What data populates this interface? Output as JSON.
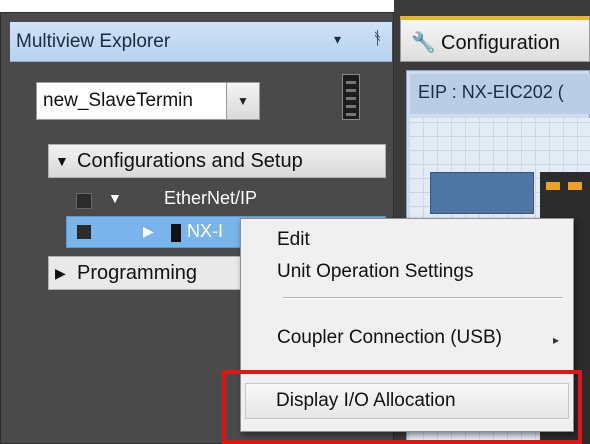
{
  "explorer": {
    "title": "Multiview Explorer",
    "dropdown_glyph": "▾",
    "pin_glyph": "ᚬ",
    "device_select": {
      "value": "new_SlaveTermin",
      "arrow": "▼"
    },
    "sections": {
      "configurations": {
        "label": "Configurations and Setup",
        "expander": "▼"
      },
      "programming": {
        "label": "Programming",
        "expander": "▶"
      }
    },
    "tree": {
      "ethernet_ip": {
        "label": "EtherNet/IP",
        "expander": "▼"
      },
      "nx_node": {
        "label": "NX-I",
        "expander": "▶"
      }
    }
  },
  "editor": {
    "tab_label": "Configuration",
    "canvas_header": "EIP : NX-EIC202 ("
  },
  "context_menu": {
    "items": [
      {
        "label": "Edit"
      },
      {
        "label": "Unit Operation Settings"
      },
      {
        "label": "Coupler Connection (USB)",
        "submenu_arrow": "▸"
      },
      {
        "label": "Display I/O Allocation"
      }
    ]
  },
  "colors": {
    "panel_bg": "#4a4a4a",
    "title_bar": "#cfe2f6",
    "selected_row": "#79b4ea",
    "highlight_box": "#e01515"
  },
  "icons": {
    "tab_icon": "wrench-icon",
    "pin": "pin-icon",
    "device": "device-thumbnail-icon"
  }
}
